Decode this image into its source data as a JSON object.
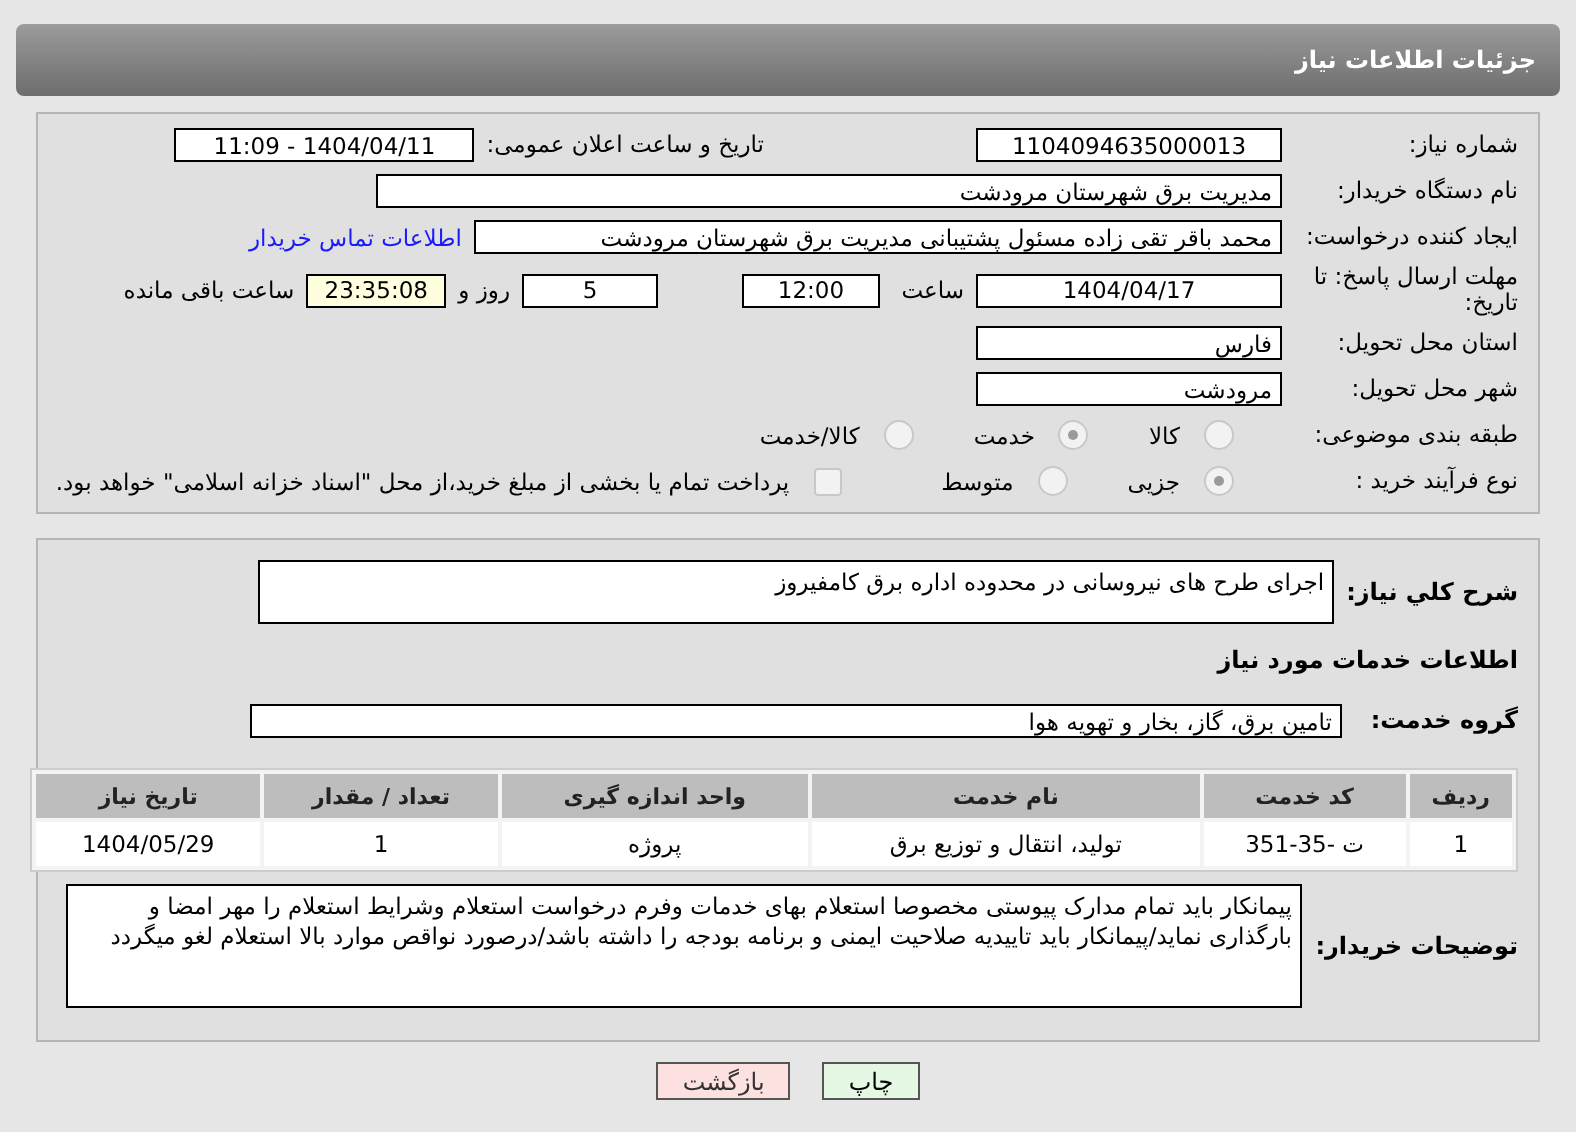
{
  "header": {
    "title": "جزئیات اطلاعات نیاز"
  },
  "details": {
    "need_number": {
      "label": "شماره نیاز:",
      "value": "1104094635000013"
    },
    "announce": {
      "label": "تاریخ و ساعت اعلان عمومی:",
      "value": "1404/04/11 - 11:09"
    },
    "buyer": {
      "label": "نام دستگاه خریدار:",
      "value": "مدیریت برق شهرستان مرودشت"
    },
    "creator": {
      "label": "ایجاد کننده درخواست:",
      "value": "محمد باقر  تقی زاده مسئول پشتیبانی مدیریت برق شهرستان مرودشت",
      "link": "اطلاعات تماس خریدار"
    },
    "deadline": {
      "label": "مهلت ارسال پاسخ: تا تاریخ:",
      "date": "1404/04/17",
      "time_label": "ساعت",
      "time": "12:00",
      "days": "5",
      "days_label": "روز و",
      "remaining": "23:35:08",
      "remaining_label": "ساعت باقی مانده"
    },
    "province": {
      "label": "استان محل تحویل:",
      "value": "فارس"
    },
    "city": {
      "label": "شهر محل تحویل:",
      "value": "مرودشت"
    },
    "category": {
      "label": "طبقه بندی موضوعی:",
      "options": [
        {
          "label": "کالا",
          "selected": false
        },
        {
          "label": "خدمت",
          "selected": true
        },
        {
          "label": "کالا/خدمت",
          "selected": false
        }
      ]
    },
    "purchase_type": {
      "label": "نوع فرآیند خرید :",
      "options": [
        {
          "label": "جزیی",
          "selected": true
        },
        {
          "label": "متوسط",
          "selected": false
        }
      ],
      "payment": {
        "label": "پرداخت تمام یا بخشی از مبلغ خرید،از محل \"اسناد خزانه اسلامی\" خواهد بود.",
        "checked": false
      }
    }
  },
  "needs": {
    "description": {
      "label": "شرح کلي نیاز:",
      "value": "اجرای طرح های نیروسانی در محدوده اداره برق کامفیروز"
    },
    "services_heading": "اطلاعات خدمات مورد نیاز",
    "service_group": {
      "label": "گروه خدمت:",
      "value": "تامین برق، گاز، بخار و تهویه هوا"
    },
    "table": {
      "columns": [
        "ردیف",
        "کد خدمت",
        "نام خدمت",
        "واحد اندازه گیری",
        "تعداد / مقدار",
        "تاریخ نیاز"
      ],
      "rows": [
        [
          "1",
          "ت -35-351",
          "تولید، انتقال و توزیع برق",
          "پروژه",
          "1",
          "1404/05/29"
        ]
      ]
    },
    "buyer_notes": {
      "label": "توضیحات خریدار:",
      "value": "پیمانکار باید تمام مدارک پیوستی مخصوصا استعلام بهای خدمات وفرم درخواست استعلام وشرایط استعلام را مهر امضا و بارگذاری نماید/پیمانکار باید تاییدیه صلاحیت ایمنی و برنامه بودجه را داشته باشد/درصورد نواقص موارد بالا استعلام لغو میگردد"
    }
  },
  "buttons": {
    "back": "بازگشت",
    "print": "چاپ"
  }
}
